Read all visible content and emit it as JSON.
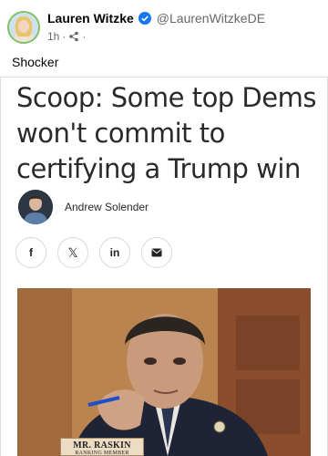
{
  "post": {
    "author_name": "Lauren Witzke",
    "handle": "@LaurenWitzkeDE",
    "time": "1h",
    "text": "Shocker",
    "verified_icon": "verified-badge-icon",
    "audience_icon": "share-audience-icon"
  },
  "article": {
    "headline": "Scoop: Some top Dems won't commit to certifying a Trump win",
    "author": "Andrew Solender",
    "share_buttons": [
      {
        "name": "facebook",
        "label": "f"
      },
      {
        "name": "x",
        "label": "𝕏"
      },
      {
        "name": "linkedin",
        "label": "in"
      },
      {
        "name": "email",
        "label": ""
      }
    ],
    "photo": {
      "nameplate": "MR. RASKIN",
      "nameplate_sub": "RANKING MEMBER"
    }
  },
  "colors": {
    "verified": "#1877f2",
    "meta": "#65676b",
    "headline": "#2a2a2a"
  }
}
